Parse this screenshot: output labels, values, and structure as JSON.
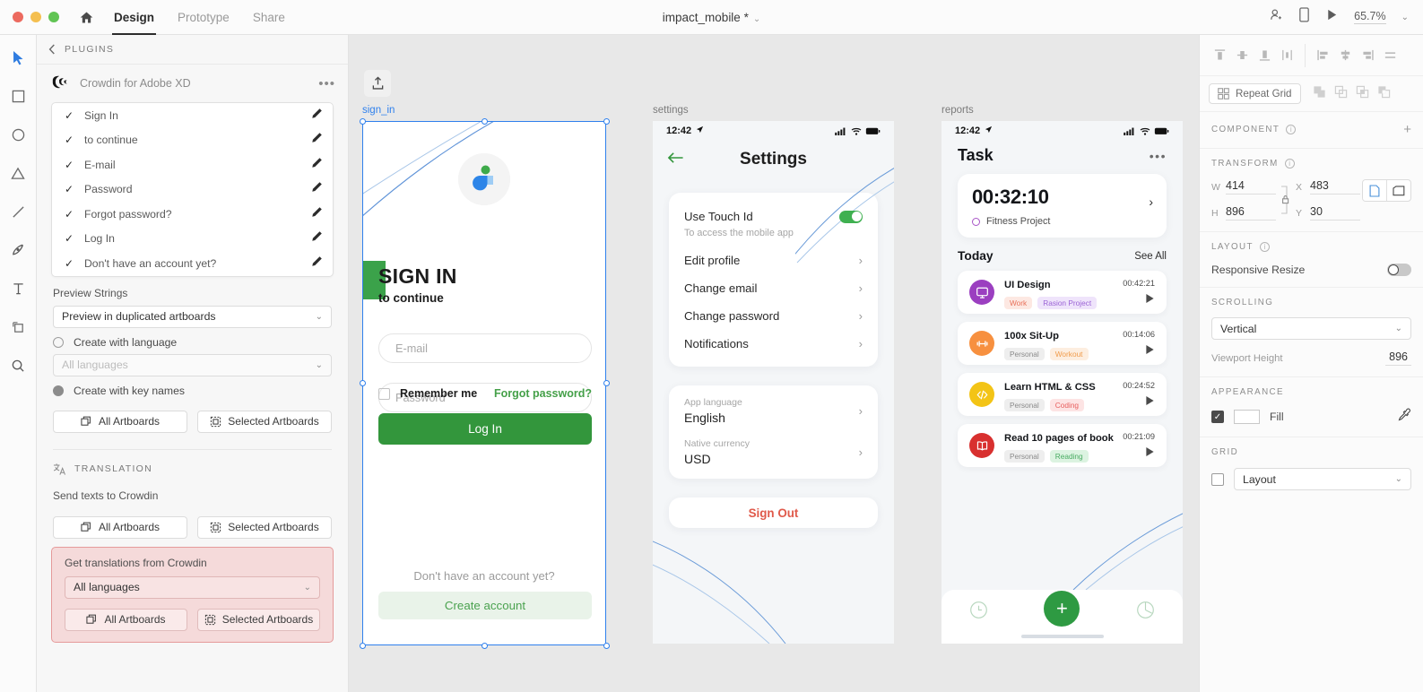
{
  "topbar": {
    "window_controls": [
      "close",
      "minimize",
      "zoom"
    ],
    "home_icon": "home-icon",
    "tabs": [
      {
        "label": "Design",
        "active": true
      },
      {
        "label": "Prototype",
        "active": false
      },
      {
        "label": "Share",
        "active": false
      }
    ],
    "document_title": "impact_mobile *",
    "title_caret": "⌄",
    "icons": [
      "add-collaborator-icon",
      "device-preview-icon",
      "play-icon"
    ],
    "zoom_level": "65.7%",
    "zoom_caret": "⌄"
  },
  "left_toolbar": {
    "tools": [
      {
        "name": "select-tool",
        "glyph": "▶"
      },
      {
        "name": "rectangle-tool",
        "glyph": "□"
      },
      {
        "name": "ellipse-tool",
        "glyph": "○"
      },
      {
        "name": "polygon-tool",
        "glyph": "△"
      },
      {
        "name": "line-tool",
        "glyph": "╱"
      },
      {
        "name": "pen-tool",
        "glyph": "✒"
      },
      {
        "name": "text-tool",
        "glyph": "T"
      },
      {
        "name": "artboard-tool",
        "glyph": "⬚"
      },
      {
        "name": "zoom-tool",
        "glyph": "⌕"
      }
    ]
  },
  "plugin_panel": {
    "back_label": "PLUGINS",
    "plugin_name": "Crowdin for Adobe XD",
    "overflow": "•••",
    "strings": [
      {
        "label": "Sign In"
      },
      {
        "label": "to continue"
      },
      {
        "label": "E-mail"
      },
      {
        "label": "Password"
      },
      {
        "label": "Forgot password?"
      },
      {
        "label": "Log In"
      },
      {
        "label": "Don't have an account yet?"
      }
    ],
    "preview_strings_label": "Preview Strings",
    "preview_select_value": "Preview in duplicated artboards",
    "radio_language_label": "Create with language",
    "language_select_placeholder": "All languages",
    "radio_keynames_label": "Create with key names",
    "preview_buttons": {
      "all": "All Artboards",
      "selected": "Selected Artboards"
    },
    "translation_section_title": "TRANSLATION",
    "send_label": "Send texts to Crowdin",
    "send_buttons": {
      "all": "All Artboards",
      "selected": "Selected Artboards"
    },
    "get_label": "Get translations from Crowdin",
    "get_select_value": "All languages",
    "get_buttons": {
      "all": "All Artboards",
      "selected": "Selected Artboards"
    },
    "highlight_color": "#e59a9a"
  },
  "canvas": {
    "artboards": [
      {
        "name": "sign_in",
        "selected": true
      },
      {
        "name": "settings",
        "selected": false
      },
      {
        "name": "reports",
        "selected": false
      }
    ],
    "sign_in": {
      "title": "SIGN IN",
      "subtitle": "to continue",
      "email_placeholder": "E-mail",
      "password_placeholder": "Password",
      "remember_label": "Remember me",
      "forgot_label": "Forgot password?",
      "login_button": "Log In",
      "no_account_text": "Don't have an account yet?",
      "create_button": "Create account",
      "accent_green": "#33963c",
      "link_green": "#45a049"
    },
    "settings": {
      "status_time": "12:42",
      "header_title": "Settings",
      "back_icon": "back-arrow-icon",
      "touch_id_label": "Use Touch Id",
      "touch_id_sub": "To access the mobile app",
      "touch_id_on": true,
      "rows": [
        {
          "label": "Edit profile"
        },
        {
          "label": "Change email"
        },
        {
          "label": "Change password"
        },
        {
          "label": "Notifications"
        }
      ],
      "app_language_key": "App language",
      "app_language_value": "English",
      "native_currency_key": "Native currency",
      "native_currency_value": "USD",
      "sign_out": "Sign Out",
      "sign_out_color": "#e05a4b"
    },
    "reports": {
      "status_time": "12:42",
      "header_title": "Task",
      "overflow": "•••",
      "timer_value": "00:32:10",
      "timer_project": "Fitness Project",
      "today_label": "Today",
      "see_all_label": "See All",
      "tasks": [
        {
          "name": "UI Design",
          "duration": "00:42:21",
          "icon": "monitor-icon",
          "avatar_color": "#9b3fc0",
          "tags": [
            {
              "text": "Work",
              "bg": "#fde8e2",
              "fg": "#e8715a"
            },
            {
              "text": "Rasion Project",
              "bg": "#efe4fb",
              "fg": "#9b63d6"
            }
          ]
        },
        {
          "name": "100x Sit-Up",
          "duration": "00:14:06",
          "icon": "dumbbell-icon",
          "avatar_color": "#f7903f",
          "tags": [
            {
              "text": "Personal",
              "bg": "#eeeeee",
              "fg": "#8a8a8a"
            },
            {
              "text": "Workout",
              "bg": "#fdeee0",
              "fg": "#f09b4a"
            }
          ]
        },
        {
          "name": "Learn HTML & CSS",
          "duration": "00:24:52",
          "icon": "code-icon",
          "avatar_color": "#f3c416",
          "tags": [
            {
              "text": "Personal",
              "bg": "#eeeeee",
              "fg": "#8a8a8a"
            },
            {
              "text": "Coding",
              "bg": "#fde4e4",
              "fg": "#e8605f"
            }
          ]
        },
        {
          "name": "Read 10 pages of book",
          "duration": "00:21:09",
          "icon": "book-icon",
          "avatar_color": "#d8302f",
          "tags": [
            {
              "text": "Personal",
              "bg": "#eeeeee",
              "fg": "#8a8a8a"
            },
            {
              "text": "Reading",
              "bg": "#dcf3e1",
              "fg": "#49ab62"
            }
          ]
        }
      ],
      "tabbar": {
        "left_icon": "clock-icon",
        "fab_icon": "plus-icon",
        "right_icon": "pie-chart-icon"
      }
    }
  },
  "right_panel": {
    "align_icons": [
      "align-top-icon",
      "align-vertical-center-icon",
      "align-bottom-icon",
      "align-horizontal-center-icon",
      "align-left-icon",
      "distribute-vertical-icon",
      "align-right-icon",
      "distribute-horizontal-icon"
    ],
    "repeat_grid_label": "Repeat Grid",
    "boolean_icons": [
      "add-icon",
      "subtract-icon",
      "intersect-icon",
      "exclude-overlap-icon"
    ],
    "component_title": "COMPONENT",
    "component_plus": "+",
    "transform_title": "TRANSFORM",
    "transform": {
      "w_key": "W",
      "w_value": "414",
      "h_key": "H",
      "h_value": "896",
      "x_key": "X",
      "x_value": "483",
      "y_key": "Y",
      "y_value": "30"
    },
    "orientation_icons": [
      "portrait-icon",
      "landscape-icon"
    ],
    "layout_title": "LAYOUT",
    "responsive_resize_label": "Responsive Resize",
    "responsive_resize_on": false,
    "scrolling_title": "SCROLLING",
    "scrolling_value": "Vertical",
    "viewport_height_label": "Viewport Height",
    "viewport_height_value": "896",
    "appearance_title": "APPEARANCE",
    "fill_label": "Fill",
    "fill_checked": true,
    "fill_color": "#ffffff",
    "eyedropper_icon": "eyedropper-icon",
    "grid_title": "GRID",
    "grid_checked": false,
    "grid_value": "Layout"
  }
}
